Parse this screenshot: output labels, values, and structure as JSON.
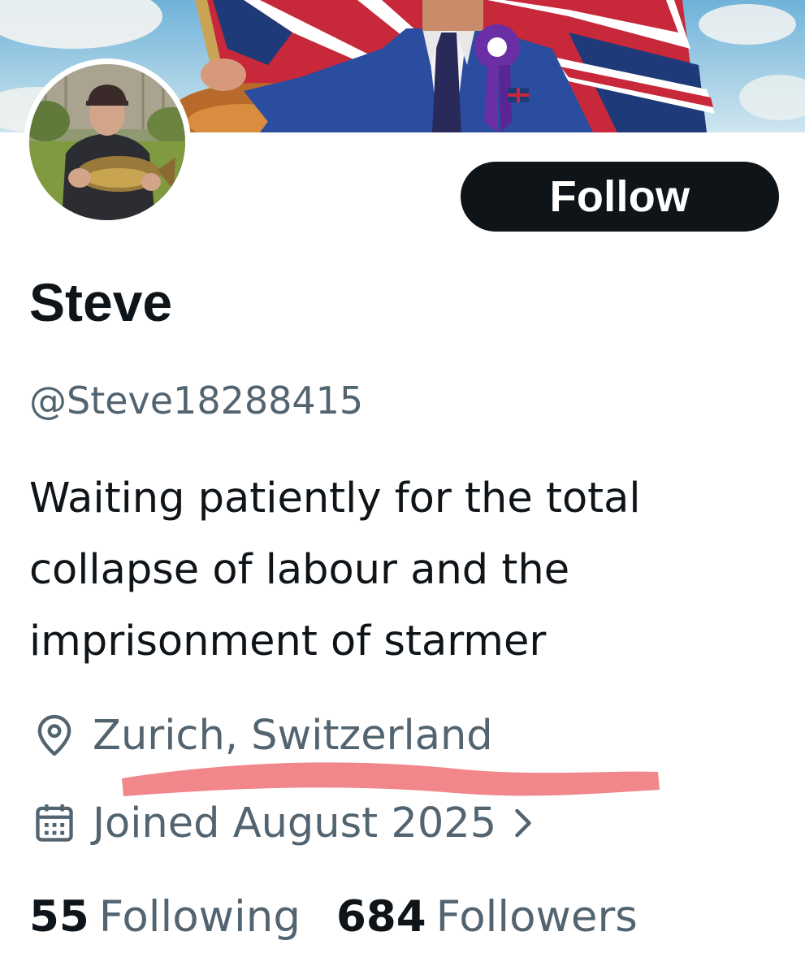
{
  "profile": {
    "display_name": "Steve",
    "handle": "@Steve18288415",
    "bio": "Waiting patiently for the total\ncollapse of labour and the\nimprisonment of starmer",
    "location": "Zurich, Switzerland",
    "joined": "Joined August 2025",
    "following_count": "55",
    "following_label": "Following",
    "followers_count": "684",
    "followers_label": "Followers"
  },
  "actions": {
    "follow_label": "Follow"
  },
  "icons": {
    "location": "location-pin-icon",
    "joined": "calendar-icon",
    "joined_more": "chevron-right-icon"
  },
  "colors": {
    "text_primary": "#0f1419",
    "text_secondary": "#536471",
    "button_bg": "#0f1419",
    "button_text": "#ffffff",
    "highlight_stroke": "#f07d80"
  }
}
